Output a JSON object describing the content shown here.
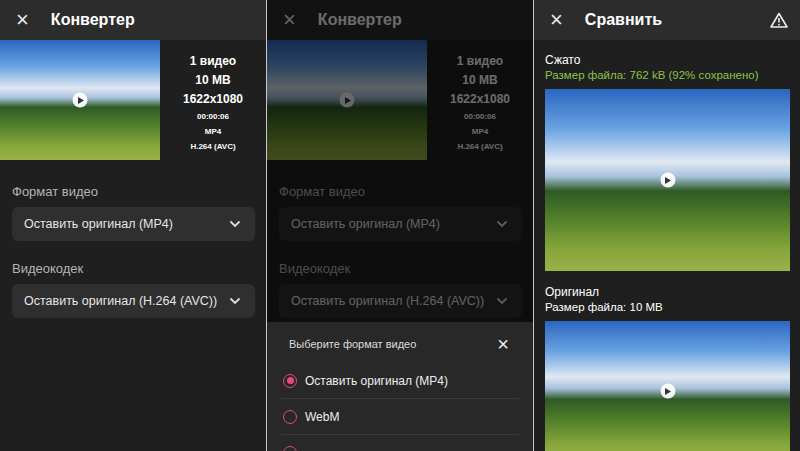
{
  "panels": [
    {
      "kind": "converter",
      "title": "Конвертер",
      "close": "×",
      "dimmed": false,
      "summary": [
        "1 видео",
        "10 MB",
        "1622x1080",
        "00:00:06",
        "MP4",
        "H.264 (AVC)"
      ],
      "fields": [
        {
          "label": "Формат видео",
          "value": "Оставить оригинал (MP4)"
        },
        {
          "label": "Видеокодек",
          "value": "Оставить оригинал (H.264 (AVC))"
        }
      ]
    },
    {
      "kind": "converter",
      "title": "Конвертер",
      "close": "×",
      "dimmed": true,
      "summary": [
        "1 видео",
        "10 MB",
        "1622x1080",
        "00:00:06",
        "MP4",
        "H.264 (AVC)"
      ],
      "fields": [
        {
          "label": "Формат видео",
          "value": "Оставить оригинал (MP4)"
        },
        {
          "label": "Видеокодек",
          "value": "Оставить оригинал (H.264 (AVC))"
        }
      ],
      "sheet": {
        "title": "Выберите формат видео",
        "close": "×",
        "options": [
          {
            "label": "Оставить оригинал (MP4)",
            "selected": true
          },
          {
            "label": "WebM",
            "selected": false
          },
          {
            "label": "",
            "selected": false
          }
        ]
      }
    },
    {
      "kind": "compare",
      "title": "Сравнить",
      "close": "×",
      "items": [
        {
          "label": "Сжато",
          "size": "Размер файла: 762 kB (92% сохранено)",
          "color": "#8bc34a"
        },
        {
          "label": "Оригинал",
          "size": "Размер файла: 10 MB",
          "color": "#ffffff"
        }
      ]
    }
  ]
}
